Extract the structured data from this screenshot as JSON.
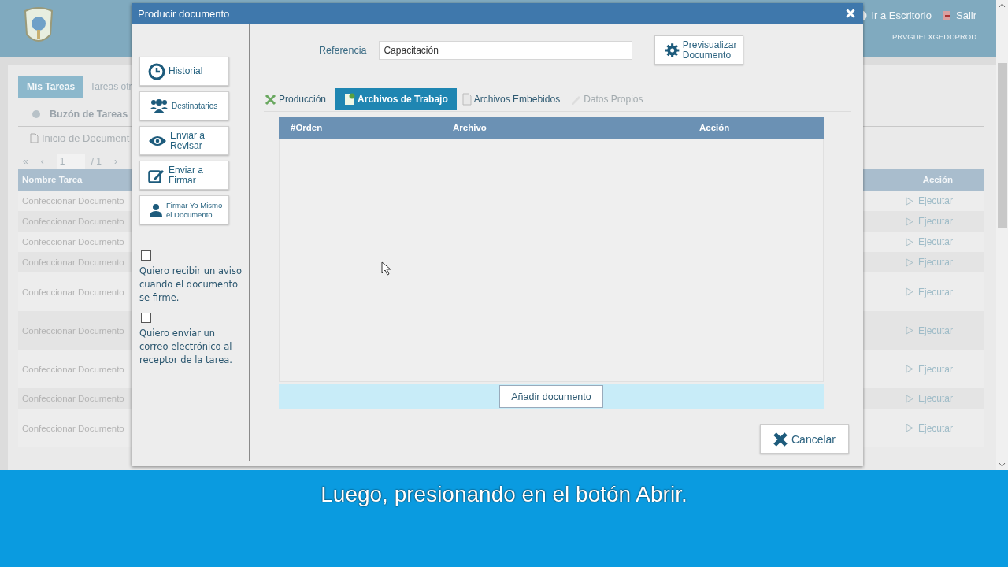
{
  "background_page": {
    "header": {
      "links": [
        {
          "label": "Ir a Escritorio",
          "kind": "desktop"
        },
        {
          "label": "Salir",
          "kind": "exit"
        }
      ],
      "user": "PRVGDELXGEDOPROD"
    },
    "tabs": [
      {
        "label": "Mis Tareas",
        "selected": true
      },
      {
        "label": "Tareas otr",
        "selected": false
      }
    ],
    "inbox_title": "Buzón de Tareas",
    "section_link": "Inicio de Document",
    "pager": {
      "first": "«",
      "prev": "‹",
      "page": "1",
      "total": "/ 1",
      "next": "›"
    },
    "table": {
      "columns": [
        "Nombre Tarea",
        "Acción"
      ],
      "rows": [
        {
          "task": "Confeccionar Documento",
          "action": "Ejecutar",
          "tall": false
        },
        {
          "task": "Confeccionar Documento",
          "action": "Ejecutar",
          "tall": false
        },
        {
          "task": "Confeccionar Documento",
          "action": "Ejecutar",
          "tall": false
        },
        {
          "task": "Confeccionar Documento",
          "action": "Ejecutar",
          "tall": false
        },
        {
          "task": "Confeccionar Documento",
          "action": "Ejecutar",
          "tall": true
        },
        {
          "task": "Confeccionar Documento",
          "action": "Ejecutar",
          "tall": true
        },
        {
          "task": "Confeccionar Documento",
          "action": "Ejecutar",
          "tall": true
        },
        {
          "task": "Confeccionar Documento",
          "action": "Ejecutar",
          "tall": false
        },
        {
          "task": "Confeccionar Documento",
          "action": "Ejecutar",
          "tall": true
        }
      ]
    }
  },
  "dialog": {
    "title": "Producir documento",
    "side_buttons": [
      {
        "label": "Historial",
        "kind": "clock"
      },
      {
        "label": "Destinatarios",
        "kind": "people"
      },
      {
        "label": "Enviar a\nRevisar",
        "kind": "eye"
      },
      {
        "label": "Enviar a\nFirmar",
        "kind": "edit"
      },
      {
        "label": "Firmar Yo Mismo\nel Documento",
        "kind": "user"
      }
    ],
    "options": [
      {
        "label": "Quiero recibir un aviso\ncuando el documento\nse firme.",
        "checked": false
      },
      {
        "label": "Quiero enviar un\ncorreo electrónico al\nreceptor de la tarea.",
        "checked": false
      }
    ],
    "reference": {
      "label": "Referencia",
      "value": "Capacitación"
    },
    "preview_button": "Previsualizar\nDocumento",
    "tabs": [
      {
        "label": "Producción",
        "kind": "tools",
        "selected": false,
        "disabled": false
      },
      {
        "label": "Archivos de Trabajo",
        "kind": "file",
        "selected": true,
        "disabled": false
      },
      {
        "label": "Archivos Embebidos",
        "kind": "attach",
        "selected": false,
        "disabled": false
      },
      {
        "label": "Datos Propios",
        "kind": "pencil",
        "selected": false,
        "disabled": true
      }
    ],
    "files_table": {
      "columns": [
        "#Orden",
        "Archivo",
        "Acción"
      ]
    },
    "add_button": "Añadir documento",
    "cancel_button": "Cancelar"
  },
  "subtitle": "Luego, presionando en el botón Abrir."
}
